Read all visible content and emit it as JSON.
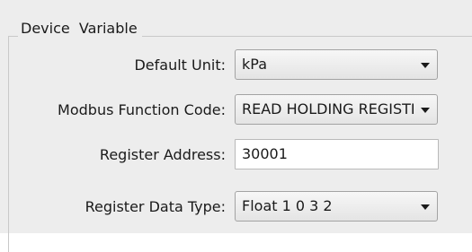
{
  "group": {
    "title": "Device  Variable"
  },
  "fields": {
    "default_unit": {
      "label": "Default Unit:",
      "value": "kPa"
    },
    "modbus_function_code": {
      "label": "Modbus Function Code:",
      "value": "READ HOLDING REGISTERS"
    },
    "register_address": {
      "label": "Register Address:",
      "value": "30001"
    },
    "register_data_type": {
      "label": "Register Data Type:",
      "value": "Float 1 0 3 2"
    }
  },
  "icons": {
    "dropdown": "chevron-down-icon"
  },
  "colors": {
    "panel_background": "#ededed",
    "field_border": "#a3a3a3",
    "text": "#1a1a1a"
  }
}
